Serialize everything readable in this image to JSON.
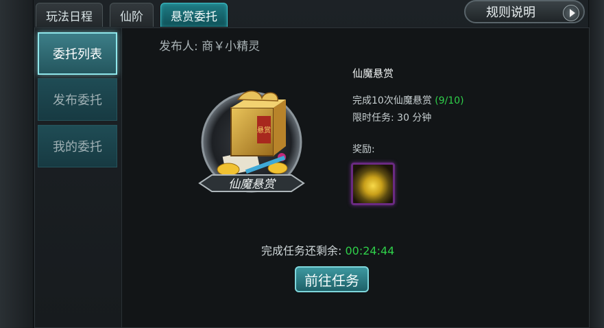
{
  "tabs": [
    {
      "label": "玩法日程",
      "active": false
    },
    {
      "label": "仙阶",
      "active": false
    },
    {
      "label": "悬赏委托",
      "active": true
    }
  ],
  "rules_button": {
    "label": "规则说明",
    "icon": "play-icon"
  },
  "sidebar": {
    "items": [
      {
        "label": "委托列表",
        "active": true
      },
      {
        "label": "发布委托",
        "active": false
      },
      {
        "label": "我的委托",
        "active": false
      }
    ]
  },
  "publisher": {
    "label": "发布人: 商￥小精灵"
  },
  "emblem": {
    "caption": "仙魔悬赏",
    "box_mark": "悬赏"
  },
  "quest": {
    "title": "仙魔悬赏",
    "objective": "完成10次仙魔悬赏",
    "progress": "(9/10)",
    "time_limit": "限时任务: 30 分钟",
    "reward_label": "奖励:",
    "reward_icon": "gold-ingot-pile-icon"
  },
  "remaining": {
    "label": "完成任务还剩余:",
    "timer": "00:24:44"
  },
  "go_button": {
    "label": "前往任务"
  },
  "colors": {
    "accent": "#3ec0c9",
    "timer": "#2fd04a",
    "reward_border": "#6a2a82"
  }
}
